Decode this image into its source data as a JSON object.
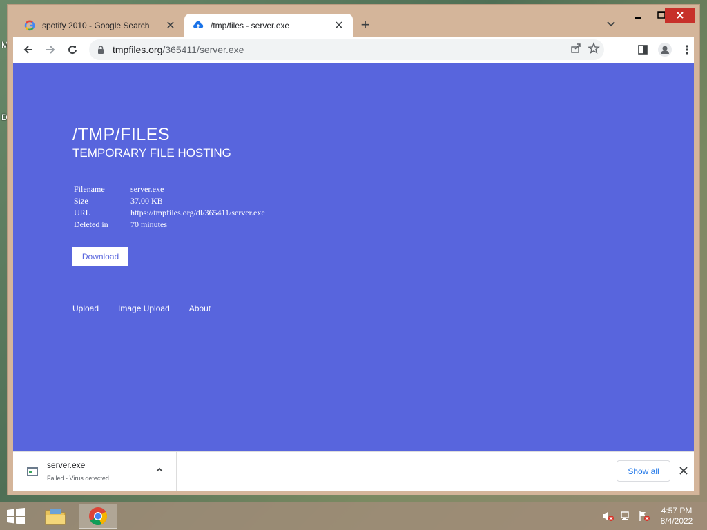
{
  "desktop": {
    "letters": [
      "M",
      "D"
    ]
  },
  "browser": {
    "tabs": [
      {
        "title": "spotify 2010 - Google Search",
        "favicon": "google-icon",
        "active": false
      },
      {
        "title": "/tmp/files - server.exe",
        "favicon": "cloud-upload-icon",
        "active": true
      }
    ],
    "address": {
      "domain": "tmpfiles.org",
      "path": "/365411/server.exe"
    }
  },
  "page": {
    "title": "/TMP/FILES",
    "subtitle": "TEMPORARY FILE HOSTING",
    "file_info": [
      {
        "label": "Filename",
        "value": "server.exe"
      },
      {
        "label": "Size",
        "value": "37.00 KB"
      },
      {
        "label": "URL",
        "value": "https://tmpfiles.org/dl/365411/server.exe"
      },
      {
        "label": "Deleted in",
        "value": "70 minutes"
      }
    ],
    "download_label": "Download",
    "footer_links": [
      "Upload",
      "Image Upload",
      "About"
    ],
    "background_color": "#5865dd"
  },
  "download_shelf": {
    "filename": "server.exe",
    "status": "Failed - Virus detected",
    "show_all_label": "Show all"
  },
  "taskbar": {
    "time": "4:57 PM",
    "date": "8/4/2022"
  }
}
